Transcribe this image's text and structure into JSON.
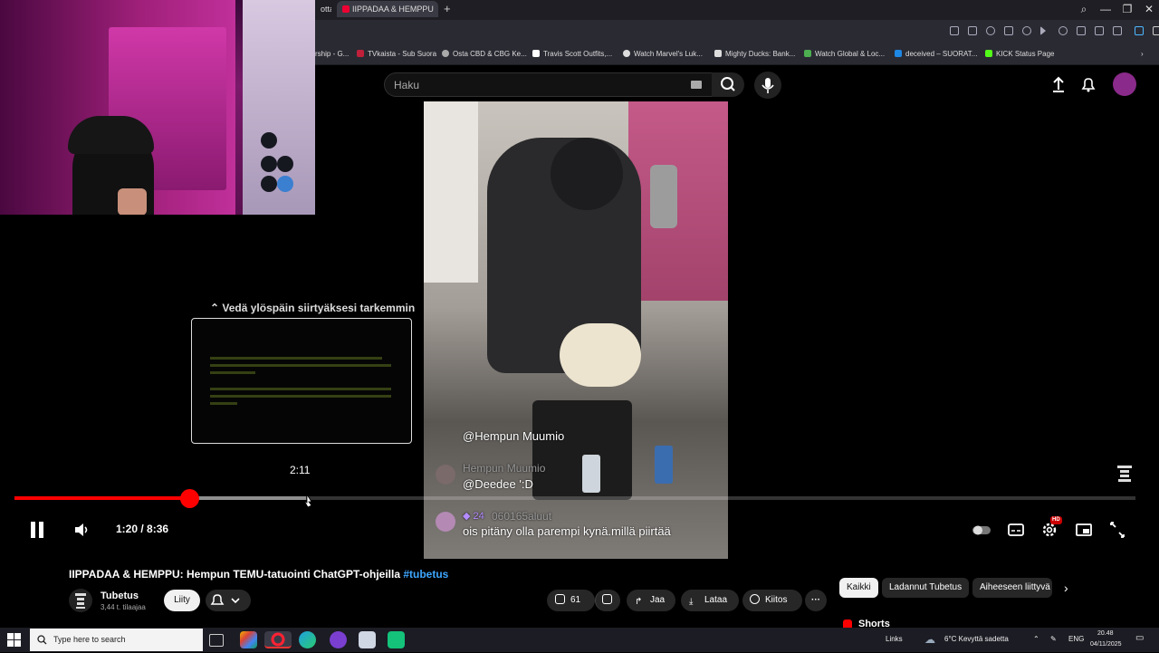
{
  "browser": {
    "prev_tab_label": "otta",
    "active_tab_label": "IIPPADAA & HEMPPU",
    "new_tab_symbol": "+",
    "window_controls": {
      "minimize": "—",
      "restore": "❐",
      "close": "✕"
    },
    "bookmarks": [
      {
        "label": "rship - G...",
        "color": "#888888"
      },
      {
        "label": "TVkaista - Sub Suora",
        "color": "#c0203a"
      },
      {
        "label": "Osta CBD & CBG Ke...",
        "color": "#aaaaaa"
      },
      {
        "label": "Travis Scott Outfits,...",
        "color": "#ffffff"
      },
      {
        "label": "Watch Marvel's Luk...",
        "color": "#dddddd"
      },
      {
        "label": "Mighty Ducks: Bank...",
        "color": "#dddddd"
      },
      {
        "label": "Watch Global & Loc...",
        "color": "#4caf50"
      },
      {
        "label": "deceived – SUORAT...",
        "color": "#1e88e5"
      },
      {
        "label": "KICK Status Page",
        "color": "#53fc18"
      }
    ]
  },
  "header": {
    "search_placeholder": "Haku"
  },
  "video": {
    "overlay": {
      "comment1_user": "@Hempun Muumio",
      "comment2_author": "Hempun Muumio",
      "comment2_text": "@Deedee ':D",
      "comment3_badge": "24",
      "comment3_author": "060165aluut",
      "comment3_text": "ois pitäny olla parempi kynä.millä piirtää"
    },
    "drag_hint": "Vedä ylöspäin siirtyäksesi tarkemmin",
    "hover_time": "2:11",
    "progress": {
      "played_fraction": 0.1563,
      "buffered_fraction": 0.2604,
      "hover_fraction": 0.2606
    },
    "time_display": "1:20 / 8:36",
    "hd_badge": "HD"
  },
  "watch": {
    "title": "IIPPADAA & HEMPPU: Hempun TEMU-tatuointi ChatGPT-ohjeilla",
    "hashtag": "#tubetus",
    "channel_name": "Tubetus",
    "channel_subs": "3,44 t. tilaajaa",
    "join_label": "Liity",
    "like_count": "61",
    "share_label": "Jaa",
    "download_label": "Lataa",
    "thanks_label": "Kiitos",
    "chips": [
      "Kaikki",
      "Ladannut Tubetus",
      "Aiheeseen liittyvä"
    ],
    "shorts_label": "Shorts"
  },
  "taskbar": {
    "search_placeholder": "Type here to search",
    "links_label": "Links",
    "weather": "6°C  Kevyttä sadetta",
    "language": "ENG",
    "time": "20.48",
    "date": "04/11/2025"
  },
  "colors": {
    "accent_red": "#ff0000",
    "link_blue": "#3ea6ff"
  }
}
